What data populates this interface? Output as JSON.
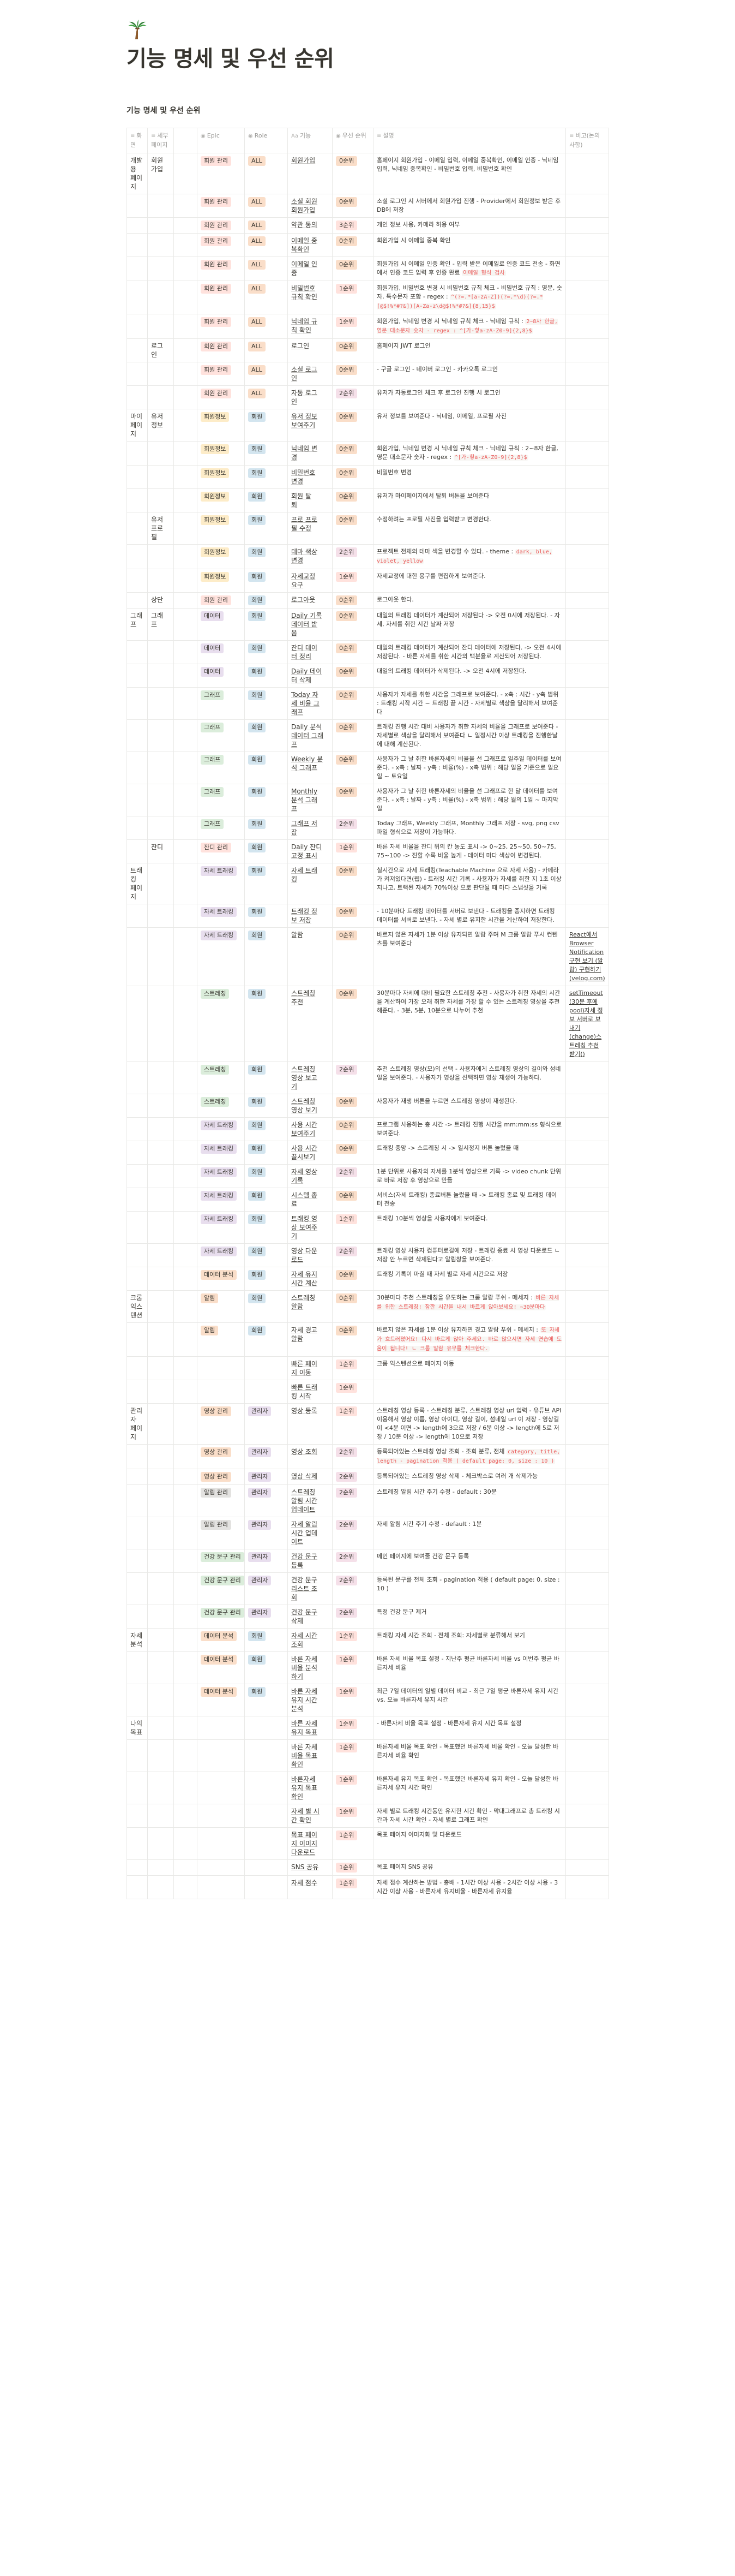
{
  "page": {
    "icon": "palm-tree-icon",
    "title": "기능 명세 및 우선 순위",
    "subpage_title": "기능 명세 및 우선 순위"
  },
  "columns": [
    "화면",
    "세부 페이지",
    "Epic",
    "Role",
    "기능",
    "우선 순위",
    "설명",
    "비고(논의사항)"
  ],
  "colors": {
    "회원 관리": "tag-red",
    "회원정보": "tag-yellow",
    "그래프": "tag-green",
    "데이터": "tag-purple",
    "잔디 관리": "tag-red",
    "자세 트래킹": "tag-purple",
    "스트레칭": "tag-green",
    "데이터 분석": "tag-orange",
    "알림": "tag-orange",
    "영상 관리": "tag-orange",
    "건강 문구 관리": "tag-green",
    "ALL": "tag-orange",
    "회원": "tag-blue",
    "관리자": "tag-purple",
    "0순위": "tag-orange",
    "1순위": "tag-red",
    "2순위": "tag-pink",
    "3순위": "tag-red"
  },
  "rows": [
    {
      "s1": "개발 용\n폐이지",
      "s2": "회원\n가입",
      "epic": "회원 관리",
      "role": "ALL",
      "feat": "회원가입",
      "pri": "0순위",
      "desc": "홈페이지 회원가입 - 이메일 입력, 이메일 중복확인, 이메일 인증 - 닉네임 입력, 닉네임 중복확인 - 비밀번호 입력, 비밀번호 확인",
      "note": ""
    },
    {
      "s1": "",
      "s2": "",
      "epic": "회원 관리",
      "role": "ALL",
      "feat": "소셜 회원\n회원가입",
      "pri": "0순위",
      "desc": "소셜 로그인 시 서버에서 회원가입 진행 - Provider에서 회원정보 받은 후 DB에 저장",
      "note": ""
    },
    {
      "s1": "",
      "s2": "",
      "epic": "회원 관리",
      "role": "ALL",
      "feat": "약관 동의",
      "pri": "3순위",
      "desc": "개인 정보 사용, 카메라 허용 여부",
      "note": ""
    },
    {
      "s1": "",
      "s2": "",
      "epic": "회원 관리",
      "role": "ALL",
      "feat": "이메일 중\n복확인",
      "pri": "0순위",
      "desc": "회원가입 시 이메일 중복 확인",
      "note": ""
    },
    {
      "s1": "",
      "s2": "",
      "epic": "회원 관리",
      "role": "ALL",
      "feat": "이메일 인\n증",
      "pri": "0순위",
      "desc": "회원가입 시 이메일 인증 확인 - 입력 받은 이메일로 인증 코드 전송 - 화면에서 인증 코드 입력 후 인증 완료",
      "note": "",
      "code": "이메일 형식 검사"
    },
    {
      "s1": "",
      "s2": "",
      "epic": "회원 관리",
      "role": "ALL",
      "feat": "비밀번호\n규칙 확인",
      "pri": "1순위",
      "desc": "회원가입, 비밀번호 변경 시 비밀번호 규칙 체크 - 비밀번호 규칙 : 영문, 숫자, 특수문자 포함 - regex :",
      "note": "",
      "code": "^(?=.*[a-zA-Z])(?=.*\\d)(?=.*[@$!%*#?&])[A-Za-z\\d@$!%*#?&]{8,15}$"
    },
    {
      "s1": "",
      "s2": "",
      "epic": "회원 관리",
      "role": "ALL",
      "feat": "닉네임 규\n칙 확인",
      "pri": "1순위",
      "desc": "회원가입, 닉네임 변경 시 닉네임 규칙 체크 - 닉네임 규칙 :",
      "note": "",
      "code": "2~8자 한글, 영문 대소문자 숫자 - regex : ^[가-힣a-zA-Z0-9]{2,8}$"
    },
    {
      "s1": "",
      "s2": "로그\n인",
      "epic": "회원 관리",
      "role": "ALL",
      "feat": "로그인",
      "pri": "0순위",
      "desc": "홈페이지 JWT 로그인",
      "note": ""
    },
    {
      "s1": "",
      "s2": "",
      "epic": "회원 관리",
      "role": "ALL",
      "feat": "소셜 로그\n인",
      "pri": "0순위",
      "desc": "- 구글 로그인 - 네이버 로그인 - 카카오톡 로그인",
      "note": ""
    },
    {
      "s1": "",
      "s2": "",
      "epic": "회원 관리",
      "role": "ALL",
      "feat": "자동 로그\n인",
      "pri": "2순위",
      "desc": "유저가 자동로그인 체크 후 로그인 진행 시 로그인",
      "note": ""
    },
    {
      "s1": "마이\n페이\n지",
      "s2": "유저\n정보",
      "epic": "회원정보",
      "role": "회원",
      "feat": "유저 정보\n보여주기",
      "pri": "0순위",
      "desc": "유저 정보를 보여준다 - 닉네임, 이메일, 프로필 사진",
      "note": ""
    },
    {
      "s1": "",
      "s2": "",
      "epic": "회원정보",
      "role": "회원",
      "feat": "닉네임 변\n경",
      "pri": "0순위",
      "desc": "회원가입, 닉네임 변경 시 닉네임 규칙 체크 - 닉네임 규칙 : 2~8자 한글, 영문 대소문자 숫자 - regex :",
      "note": "",
      "code": "^[가-힣a-zA-Z0-9]{2,8}$"
    },
    {
      "s1": "",
      "s2": "",
      "epic": "회원정보",
      "role": "회원",
      "feat": "비밀번호\n변경",
      "pri": "0순위",
      "desc": "비밀번호 변경",
      "note": ""
    },
    {
      "s1": "",
      "s2": "",
      "epic": "회원정보",
      "role": "회원",
      "feat": "회원 탈\n퇴",
      "pri": "0순위",
      "desc": "유저가 마이페이지에서 탈퇴 버튼을 보여준다",
      "note": ""
    },
    {
      "s1": "",
      "s2": "유저\n프로\n필",
      "epic": "회원정보",
      "role": "회원",
      "feat": "프로 프로\n필 수정",
      "pri": "0순위",
      "desc": "수정하려는 프로필 사진을 입력받고 변경한다.",
      "note": ""
    },
    {
      "s1": "",
      "s2": "",
      "epic": "회원정보",
      "role": "회원",
      "feat": "테마 색상\n변경",
      "pri": "2순위",
      "desc": "프로젝트 전체의 테마 색을 변경할 수 있다. - theme :",
      "note": "",
      "code": "dark, blue, violet, yellow"
    },
    {
      "s1": "",
      "s2": "",
      "epic": "회원정보",
      "role": "회원",
      "feat": "자세교정\n요구",
      "pri": "1순위",
      "desc": "자세교정에 대한 용구를 편집하게 보여준다.",
      "note": ""
    },
    {
      "s1": "",
      "s2": "상단",
      "epic": "회원 관리",
      "role": "회원",
      "feat": "로그아웃",
      "pri": "0순위",
      "desc": "로그아웃 한다.",
      "note": ""
    },
    {
      "s1": "그래\n프",
      "s2": "그래\n프",
      "epic": "데이터",
      "role": "회원",
      "feat": "Daily 기록\n데이터 받\n음",
      "pri": "0순위",
      "desc": "대일의 트래킹 데이터가 계산되어 저장된다 -> 오전 0시에 저장된다. - 자세, 자세를 취한 시간 날짜 저장",
      "note": ""
    },
    {
      "s1": "",
      "s2": "",
      "epic": "데이터",
      "role": "회원",
      "feat": "잔디 데이\n터 정리",
      "pri": "0순위",
      "desc": "대일의 트래킹 데이터가 계산되어 잔디 데이터에 저장된다. -> 오전 4시에 저장된다. - 바른 자세를 취한 시간의 백분율로 계산되어 저장된다.",
      "note": ""
    },
    {
      "s1": "",
      "s2": "",
      "epic": "데이터",
      "role": "회원",
      "feat": "Daily 데이\n터 삭제",
      "pri": "0순위",
      "desc": "대일의 트래킹 데이터가 삭제된다. -> 오전 4시에 저장된다.",
      "note": ""
    },
    {
      "s1": "",
      "s2": "",
      "epic": "그래프",
      "role": "회원",
      "feat": "Today 자\n세 비율 그\n래프",
      "pri": "0순위",
      "desc": "사용자가 자세를 취한 시간을 그래프로 보여준다. - x축 : 시간 - y축 범위 : 트래킹 시작 시간 ~ 트래킹 끝 시간 - 자세별로 색상을 달리해서 보여준다",
      "note": ""
    },
    {
      "s1": "",
      "s2": "",
      "epic": "그래프",
      "role": "회원",
      "feat": "Daily 분석\n데이터 그래\n프",
      "pri": "0순위",
      "desc": "트래킹 진행 시간 대비 사용자가 취한 자세의 비율을 그래프로 보여준다 - 자세별로 색상을 달리해서 보여준다 ㄴ 일정시간 이상 트래킹을 진행한날에 대해 계산된다.",
      "note": ""
    },
    {
      "s1": "",
      "s2": "",
      "epic": "그래프",
      "role": "회원",
      "feat": "Weekly 분\n석 그래프",
      "pri": "0순위",
      "desc": "사용자가 그 날 취한 바른자세의 비율을 선 그래프로 일주일 데이터를 보여준다. - x축 : 날짜 - y축 : 비율(%) - x축 범위 : 해당 일을 기준으로 일요일 ~ 토요일",
      "note": ""
    },
    {
      "s1": "",
      "s2": "",
      "epic": "그래프",
      "role": "회원",
      "feat": "Monthly\n분석 그래\n프",
      "pri": "0순위",
      "desc": "사용자가 그 날 취한 바른자세의 비율을 선 그래프로 한 달 데이터를 보여준다. - x축 : 날짜 - y축 : 비율(%) - x축 범위 : 해당 월의 1일 ~ 마지막일",
      "note": ""
    },
    {
      "s1": "",
      "s2": "",
      "epic": "그래프",
      "role": "회원",
      "feat": "그래프 저\n장",
      "pri": "2순위",
      "desc": "Today 그래프, Weekly 그래프, Monthly 그래프 저장 - svg, png csv 파일 형식으로 저장이 가능하다.",
      "note": ""
    },
    {
      "s1": "",
      "s2": "잔디",
      "epic": "잔디 관리",
      "role": "회원",
      "feat": "Daily 잔디\n고정 표시",
      "pri": "1순위",
      "desc": "바른 자세 비율을 잔디 위의 칸 농도 표시 -> 0~25, 25~50, 50~75, 75~100 -> 진할 수록 비율 높게 - 데이터 마다 색상이 변경된다.",
      "note": ""
    },
    {
      "s1": "트래\n킹\n페이\n지",
      "s2": "",
      "epic": "자세 트래킹",
      "role": "회원",
      "feat": "자세 트래\n킹",
      "pri": "0순위",
      "desc": "실시간으로 자세 트래킹(Teachable Machine 으로 자세 사용) - 카메라가 켜져있다면(웹) - 트래킹 시간 기록 - 사용자가 자세를 취한 지 1초 이상 지나고, 트랙된 자세가 70%이상 으로 판단될 때 마다 스냅샷을 기록",
      "note": ""
    },
    {
      "s1": "",
      "s2": "",
      "epic": "자세 트래킹",
      "role": "회원",
      "feat": "트래킹 정\n보 저장",
      "pri": "0순위",
      "desc": "- 10분마다 트래킹 데이터를 서버로 보낸다 - 트래킹을 종지하면 트래킹 데이터를 서버로 보낸다. - 자세 별로 유지한 시간을 계산하여 저장한다.",
      "note": ""
    },
    {
      "s1": "",
      "s2": "",
      "epic": "자세 트래킹",
      "role": "회원",
      "feat": "알람",
      "pri": "0순위",
      "desc": "바르지 않은 자세가 1분 이상 유지되면 알람 주며 M 크롬 알람 푸시 컨텐츠를 보여준다",
      "note": "React에서 Browser Notification 구현 보기 (알람) 구현하기 (velog.com)"
    },
    {
      "s1": "",
      "s2": "",
      "epic": "스트레칭",
      "role": "회원",
      "feat": "스트레칭\n추천",
      "pri": "0순위",
      "desc": "30분마다 자세에 대비 필요한 스트레칭 추천 - 사용자가 취한 자세의 시간을 계산하여 가장 오래 취한 자세를 가장 할 수 있는 스트레칭 영상을 추천해준다. - 3분, 5분, 10분으로 나누어 추천",
      "note": "setTimeout(30분 후에 pool)자세 정보 서버로 보내기 (change)스트레칭 추천 받기()"
    },
    {
      "s1": "",
      "s2": "",
      "epic": "스트레칭",
      "role": "회원",
      "feat": "스트레칭\n영상 보고\n기",
      "pri": "2순위",
      "desc": "추천 스트레칭 영상(모)의 선택 - 사용자에게 스트레칭 영상의 길이와 섬네일을 보여준다. - 사용자가 영상을 선택하면 영상 재생이 가능하다.",
      "note": ""
    },
    {
      "s1": "",
      "s2": "",
      "epic": "스트레칭",
      "role": "회원",
      "feat": "스트레칭\n영상 보기",
      "pri": "0순위",
      "desc": "사용자가 재생 버튼을 누르면 스트레칭 영상이 재생된다.",
      "note": ""
    },
    {
      "s1": "",
      "s2": "",
      "epic": "자세 트래킹",
      "role": "회원",
      "feat": "사용 시간\n보여주기",
      "pri": "0순위",
      "desc": "프로그램 사용하는 총 시간 -> 트래킹 진행 시간을 mm:mm:ss 형식으로 보여준다.",
      "note": ""
    },
    {
      "s1": "",
      "s2": "",
      "epic": "자세 트래킹",
      "role": "회원",
      "feat": "사용 시간\n끌시보기",
      "pri": "0순위",
      "desc": "트래킹 중앙 -> 스트레칭 시 -> 일시정지 버튼 눌렀을 때",
      "note": ""
    },
    {
      "s1": "",
      "s2": "",
      "epic": "자세 트래킹",
      "role": "회원",
      "feat": "자세 영상\n기록",
      "pri": "2순위",
      "desc": "1분 단위로 사용자의 자세를 1분씩 영상으로 기록 -> video chunk 단위로 바로 저장 후 영상으로 만듦",
      "note": ""
    },
    {
      "s1": "",
      "s2": "",
      "epic": "자세 트래킹",
      "role": "회원",
      "feat": "시스템 종\n료",
      "pri": "0순위",
      "desc": "서비스(자세 트래킹) 종료버튼 눌렀을 때 -> 트래킹 종료 및 트래킹 데이터 전송",
      "note": ""
    },
    {
      "s1": "",
      "s2": "",
      "epic": "자세 트래킹",
      "role": "회원",
      "feat": "트래킹 영\n상 보여주\n기",
      "pri": "1순위",
      "desc": "트래킹 10분씩 영상을 사용자에게 보여준다.",
      "note": ""
    },
    {
      "s1": "",
      "s2": "",
      "epic": "자세 트래킹",
      "role": "회원",
      "feat": "영상 다운\n로드",
      "pri": "2순위",
      "desc": "트래킹 영상 사용자 컴퓨터로컬에 저장 - 트래킹 종료 시 영상 다운로드 ㄴ 저장 안 누르면 삭제된다고 알림창을 보여준다.",
      "note": ""
    },
    {
      "s1": "",
      "s2": "",
      "epic": "데이터 분석",
      "role": "회원",
      "feat": "자세 유지\n시간 계산",
      "pri": "0순위",
      "desc": "트래킹 기록이 마칠 때 자세 별로 자세 시간으로 저장",
      "note": ""
    },
    {
      "s1": "크롬\n익스\n텐션",
      "s2": "",
      "epic": "알림",
      "role": "회원",
      "feat": "스트레칭\n알람",
      "pri": "0순위",
      "desc": "30분마다 추천 스트레칭을 유도하는 크롬 알람 푸쉬 - 메세지 :",
      "note": "",
      "code": "바른 자세를 위한 스트레칭! 잠깐 시간을 내서 바르게 앉아보세요! ~30분마다"
    },
    {
      "s1": "",
      "s2": "",
      "epic": "알림",
      "role": "회원",
      "feat": "자세 경고\n알람",
      "pri": "0순위",
      "desc": "바르지 않은 자세를 1분 이상 유지하면 경고 알람 푸쉬 - 메세지 :",
      "note": "",
      "code": "또 자세가 흐트러졌어요! 다시 바르게 앉아 주세요. 바로 앉으시면 자세 연습에 도움이 됩니다! ㄴ 크롬 알람 유무를 체크한다."
    },
    {
      "s1": "",
      "s2": "",
      "epic": "",
      "role": "",
      "feat": "빠른 페이\n지 이동",
      "pri": "1순위",
      "desc": "크롬 익스텐션으로 페이지 이동",
      "note": ""
    },
    {
      "s1": "",
      "s2": "",
      "epic": "",
      "role": "",
      "feat": "빠른 트래\n킹 시작",
      "pri": "1순위",
      "desc": "",
      "note": ""
    },
    {
      "s1": "관리\n자\n페이\n지",
      "s2": "",
      "epic": "영상 관리",
      "role": "관리자",
      "feat": "영상 등록",
      "pri": "1순위",
      "desc": "스트레칭 영상 등록 - 스트레칭 분류, 스트레칭 영상 url 입력 - 유튜브 API 이용해서 영상 이름, 영상 아이디, 영상 길이, 섬네일 url 이 저장 - 영상길이 <4분 이면 -> length에 3으로 저장 / 6분 이상 -> length에 5로 저장 / 10분 이상 -> length에 10으로 저장",
      "note": ""
    },
    {
      "s1": "",
      "s2": "",
      "epic": "영상 관리",
      "role": "관리자",
      "feat": "영상 조회",
      "pri": "2순위",
      "desc": "등록되어있는 스트레칭 영상 조회 - 조회 분류, 전체",
      "note": "",
      "code": "category, title, length - pagination 적용 ( default page: 0, size : 10 )"
    },
    {
      "s1": "",
      "s2": "",
      "epic": "영상 관리",
      "role": "관리자",
      "feat": "영상 삭제",
      "pri": "2순위",
      "desc": "등록되어있는 스트레칭 영상 삭제 - 체크박스로 여러 개 삭제가능",
      "note": ""
    },
    {
      "s1": "",
      "s2": "",
      "epic": "알림 관리",
      "role": "관리자",
      "feat": "스트레칭\n알림 시간\n업데이트",
      "pri": "2순위",
      "desc": "스트레칭 알림 시간 주기 수정 - default : 30분",
      "note": ""
    },
    {
      "s1": "",
      "s2": "",
      "epic": "알림 관리",
      "role": "관리자",
      "feat": "자세 알림\n시간 업데\n이트",
      "pri": "2순위",
      "desc": "자세 알림 시간 주기 수정 - default : 1분",
      "note": ""
    },
    {
      "s1": "",
      "s2": "",
      "epic": "건강 문구 관리",
      "role": "관리자",
      "feat": "건강 문구\n등록",
      "pri": "2순위",
      "desc": "메인 페이지에 보여줄 건강 문구 등록",
      "note": ""
    },
    {
      "s1": "",
      "s2": "",
      "epic": "건강 문구 관리",
      "role": "관리자",
      "feat": "건강 문구\n리스트 조\n회",
      "pri": "2순위",
      "desc": "등록된 문구를 전체 조회 - pagination 적용 ( default page: 0, size : 10 )",
      "note": ""
    },
    {
      "s1": "",
      "s2": "",
      "epic": "건강 문구 관리",
      "role": "관리자",
      "feat": "건강 문구\n삭제",
      "pri": "2순위",
      "desc": "특정 건강 문구 제거",
      "note": ""
    },
    {
      "s1": "자세\n분석",
      "s2": "",
      "epic": "데이터 분석",
      "role": "회원",
      "feat": "자세 시간\n조회",
      "pri": "1순위",
      "desc": "트래킹 자세 시간 조회 - 전체 조회: 자세별로 분류해서 보기",
      "note": ""
    },
    {
      "s1": "",
      "s2": "",
      "epic": "데이터 분석",
      "role": "회원",
      "feat": "바른 자세\n비율 분석\n하기",
      "pri": "1순위",
      "desc": "바른 자세 비율 목표 설정 - 지난주 평균 바른자세 비율 vs 이번주 평균 바른자세 비율",
      "note": ""
    },
    {
      "s1": "",
      "s2": "",
      "epic": "데이터 분석",
      "role": "회원",
      "feat": "바른 자세\n유지 시간\n분석",
      "pri": "1순위",
      "desc": "최근 7일 데이터의 일별 데이터 비교 - 최근 7일 평균 바른자세 유지 시간 vs. 오늘 바른자세 유지 시간",
      "note": ""
    },
    {
      "s1": "나의\n목표",
      "s2": "",
      "epic": "",
      "role": "",
      "feat": "바른 자세\n유지 목표",
      "pri": "1순위",
      "desc": "- 바른자세 비율 목표 설정 - 바른자세 유지 시간 목표 설정",
      "note": ""
    },
    {
      "s1": "",
      "s2": "",
      "epic": "",
      "role": "",
      "feat": "바른 자세\n비율 목표\n확인",
      "pri": "1순위",
      "desc": "바른자세 비율 목표 확인 - 목표했던 바른자세 비율 확인 - 오늘 달성한 바른자세 비율 확인",
      "note": ""
    },
    {
      "s1": "",
      "s2": "",
      "epic": "",
      "role": "",
      "feat": "바른자세\n유지 목표\n확인",
      "pri": "1순위",
      "desc": "바른자세 유지 목표 확인 - 목표했던 바른자세 유지 확인 - 오늘 달성한 바른자세 유지 시간 확인",
      "note": ""
    },
    {
      "s1": "",
      "s2": "",
      "epic": "",
      "role": "",
      "feat": "자세 별 시\n간 확인",
      "pri": "1순위",
      "desc": "자세 별로 트래킹 시간동안 유지한 시간 확인 - 막대그래프로 총 트래킹 시간과 자세 시간 확인 - 자세 별로 그래프 확인",
      "note": ""
    },
    {
      "s1": "",
      "s2": "",
      "epic": "",
      "role": "",
      "feat": "목표 페이\n지 이미지\n다운로드",
      "pri": "1순위",
      "desc": "목표 페이지 이미지화 및 다운로드",
      "note": ""
    },
    {
      "s1": "",
      "s2": "",
      "epic": "",
      "role": "",
      "feat": "SNS 공유",
      "pri": "1순위",
      "desc": "목표 페이지 SNS 공유",
      "note": ""
    },
    {
      "s1": "",
      "s2": "",
      "epic": "",
      "role": "",
      "feat": "자세 점수",
      "pri": "1순위",
      "desc": "자세 점수 계산하는 방법 - 총배 - 1시간 이상 사용 - 2시간 이상 사용 - 3시간 이상 사용 - 바른자세 유지비율 - 바른자세 유지율",
      "note": ""
    }
  ]
}
